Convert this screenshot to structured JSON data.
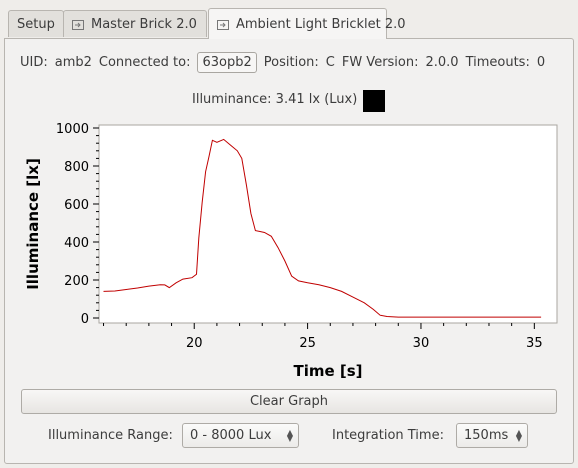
{
  "tabs": [
    {
      "label": "Setup"
    },
    {
      "label": "Master Brick 2.0"
    },
    {
      "label": "Ambient Light Bricklet 2.0"
    }
  ],
  "info": {
    "uid_label": "UID:",
    "uid_value": "amb2",
    "connected_label": "Connected to:",
    "connected_value": "63opb2",
    "position_label": "Position:",
    "position_value": "C",
    "fw_label": "FW Version:",
    "fw_value": "2.0.0",
    "timeouts_label": "Timeouts:",
    "timeouts_value": "0"
  },
  "illuminance": {
    "text": "Illuminance: 3.41 lx (Lux)",
    "color_swatch": "#000000"
  },
  "chart_data": {
    "type": "line",
    "xlabel": "Time [s]",
    "ylabel": "Illuminance [lx]",
    "xlim": [
      15.8,
      36
    ],
    "ylim": [
      0,
      1000
    ],
    "x_ticks": [
      20,
      25,
      30,
      35
    ],
    "y_ticks": [
      0,
      200,
      400,
      600,
      800,
      1000
    ],
    "line_color": "#c00000",
    "series": [
      {
        "x": [
          16.0,
          16.5,
          17.0,
          17.5,
          18.0,
          18.5,
          18.7,
          18.9,
          19.2,
          19.5,
          19.9,
          20.1,
          20.2,
          20.35,
          20.5,
          20.65,
          20.8,
          21.0,
          21.3,
          21.6,
          21.9,
          22.1,
          22.3,
          22.5,
          22.7,
          22.9,
          23.1,
          23.4,
          23.7,
          24.0,
          24.3,
          24.6,
          25.0,
          25.5,
          26.0,
          26.5,
          27.0,
          27.5,
          27.9,
          28.2,
          28.5,
          29.0,
          30.0,
          31.0,
          32.0,
          33.0,
          34.0,
          35.0,
          35.3
        ],
        "y": [
          140,
          142,
          150,
          158,
          168,
          175,
          174,
          160,
          185,
          205,
          212,
          230,
          420,
          610,
          770,
          850,
          935,
          925,
          940,
          910,
          880,
          840,
          700,
          550,
          460,
          455,
          450,
          430,
          370,
          300,
          220,
          195,
          185,
          175,
          160,
          140,
          110,
          80,
          45,
          15,
          8,
          5,
          5,
          5,
          5,
          5,
          5,
          5,
          5
        ]
      }
    ]
  },
  "clear_button_label": "Clear Graph",
  "range": {
    "label": "Illuminance Range:",
    "value": "0 - 8000 Lux"
  },
  "integration": {
    "label": "Integration Time:",
    "value": "150ms"
  }
}
